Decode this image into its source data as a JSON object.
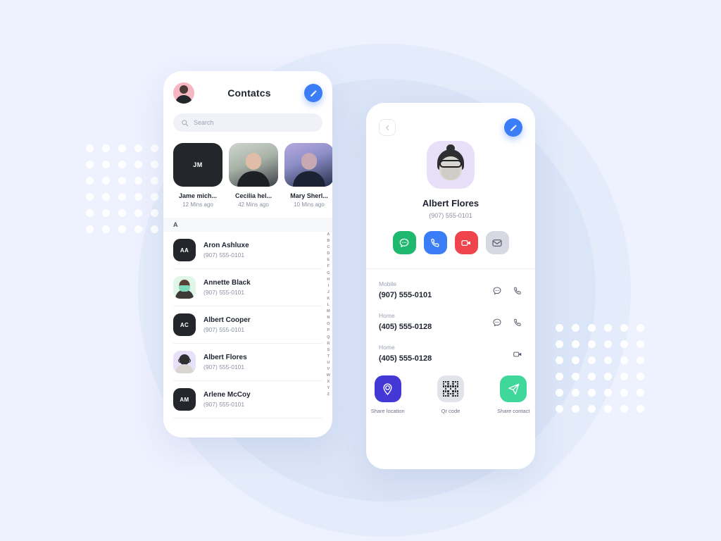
{
  "background": {
    "base_color": "#eef1fe",
    "circle_outer_color": "#e4ecfb",
    "circle_inner_color": "#dbe5f8",
    "dot_color": "#ffffff"
  },
  "contacts_screen": {
    "title": "Contatcs",
    "avatar_name": "user-avatar",
    "edit_icon": "pencil-icon",
    "edit_accent": "#3b7df6",
    "search": {
      "placeholder": "Search",
      "icon": "search-icon"
    },
    "stories": [
      {
        "name": "Jame mich...",
        "time": "12 Mins ago",
        "initials": "JM",
        "style": "dark"
      },
      {
        "name": "Cecilia hel...",
        "time": "42 Mins ago",
        "initials": "",
        "style": "photo1"
      },
      {
        "name": "Mary Sherl...",
        "time": "10 Mins ago",
        "initials": "",
        "style": "photo2"
      },
      {
        "name": "",
        "time": "",
        "initials": "",
        "style": "photo3"
      }
    ],
    "section_letter": "A",
    "contacts": [
      {
        "name": "Aron Ashluxe",
        "phone": "(907) 555-0101",
        "initials": "AA",
        "style": "dark"
      },
      {
        "name": "Annette Black",
        "phone": "(907) 555-0101",
        "initials": "",
        "style": "mint"
      },
      {
        "name": "Albert Cooper",
        "phone": "(907) 555-0101",
        "initials": "AC",
        "style": "dark"
      },
      {
        "name": "Albert Flores",
        "phone": "(907) 555-0101",
        "initials": "",
        "style": "lav"
      },
      {
        "name": "Arlene McCoy",
        "phone": "(907) 555-0101",
        "initials": "AM",
        "style": "dark"
      }
    ],
    "alphabet_index": [
      "A",
      "B",
      "C",
      "D",
      "E",
      "F",
      "G",
      "H",
      "I",
      "J",
      "K",
      "L",
      "M",
      "N",
      "O",
      "P",
      "Q",
      "R",
      "S",
      "T",
      "U",
      "V",
      "W",
      "X",
      "Y",
      "Z"
    ]
  },
  "detail_screen": {
    "back_icon": "chevron-left-icon",
    "edit_icon": "pencil-icon",
    "profile": {
      "name": "Albert Flores",
      "phone": "(907) 555-0101",
      "avatar_name": "albert-flores-avatar"
    },
    "actions": [
      {
        "name": "message",
        "icon": "chat-bubble-icon",
        "color": "#1eb96e"
      },
      {
        "name": "call",
        "icon": "phone-icon",
        "color": "#3b7df6"
      },
      {
        "name": "video",
        "icon": "video-camera-icon",
        "color": "#f0444c"
      },
      {
        "name": "mail",
        "icon": "envelope-icon",
        "color": "#d7d9e2"
      }
    ],
    "phone_entries": [
      {
        "label": "Mobile",
        "value": "(907) 555-0101",
        "icons": [
          "chat-bubble-icon",
          "phone-icon"
        ]
      },
      {
        "label": "Home",
        "value": "(405) 555-0128",
        "icons": [
          "chat-bubble-icon",
          "phone-icon"
        ]
      },
      {
        "label": "Home",
        "value": "(405) 555-0128",
        "icons": [
          "video-camera-icon"
        ]
      }
    ],
    "share_items": [
      {
        "label": "Share location",
        "icon": "location-pin-icon",
        "color": "#4338d6"
      },
      {
        "label": "Qr code",
        "icon": "qr-code-icon",
        "color": "#e2e3ea"
      },
      {
        "label": "Share contact",
        "icon": "paper-plane-icon",
        "color": "#3fd79a"
      }
    ]
  }
}
